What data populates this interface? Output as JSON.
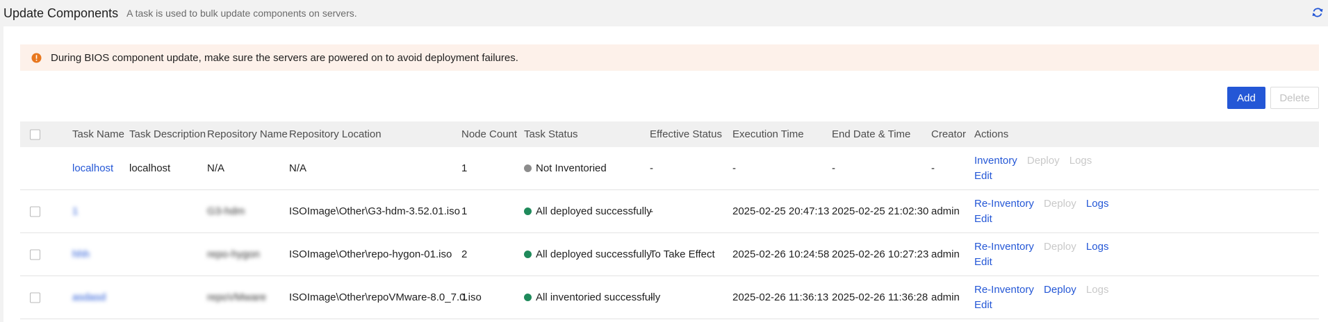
{
  "header": {
    "title": "Update Components",
    "subtitle": "A task is used to bulk update components on servers."
  },
  "alert": {
    "message": "During BIOS component update, make sure the servers are powered on to avoid deployment failures."
  },
  "toolbar": {
    "add_label": "Add",
    "delete_label": "Delete"
  },
  "columns": {
    "task_name": "Task Name",
    "task_description": "Task Description",
    "repository_name": "Repository Name",
    "repository_location": "Repository Location",
    "node_count": "Node Count",
    "task_status": "Task Status",
    "effective_status": "Effective Status",
    "execution_time": "Execution Time",
    "end_date_time": "End Date & Time",
    "creator": "Creator",
    "actions": "Actions"
  },
  "rows": [
    {
      "task_name": "localhost",
      "task_description": "localhost",
      "repository_name": "N/A",
      "repository_location": "N/A",
      "node_count": "1",
      "task_status": "Not Inventoried",
      "status_color": "#8c8c8c",
      "effective_status": "-",
      "execution_time": "-",
      "end_date_time": "-",
      "creator": "-",
      "action_inventory": "Inventory",
      "action_deploy": "Deploy",
      "action_logs": "Logs",
      "action_edit": "Edit"
    },
    {
      "task_name": "1",
      "task_description": "",
      "repository_name": "G3-hdm",
      "repository_location": "ISOImage\\Other\\G3-hdm-3.52.01.iso",
      "node_count": "1",
      "task_status": "All deployed successfully",
      "status_color": "#1f8a5b",
      "effective_status": "-",
      "execution_time": "2025-02-25 20:47:13",
      "end_date_time": "2025-02-25 21:02:30",
      "creator": "admin",
      "action_inventory": "Re-Inventory",
      "action_deploy": "Deploy",
      "action_logs": "Logs",
      "action_edit": "Edit"
    },
    {
      "task_name": "hhh",
      "task_description": "",
      "repository_name": "repo-hygon",
      "repository_location": "ISOImage\\Other\\repo-hygon-01.iso",
      "node_count": "2",
      "task_status": "All deployed successfully",
      "status_color": "#1f8a5b",
      "effective_status": "To Take Effect",
      "execution_time": "2025-02-26 10:24:58",
      "end_date_time": "2025-02-26 10:27:23",
      "creator": "admin",
      "action_inventory": "Re-Inventory",
      "action_deploy": "Deploy",
      "action_logs": "Logs",
      "action_edit": "Edit"
    },
    {
      "task_name": "asdasd",
      "task_description": "",
      "repository_name": "repoVMware",
      "repository_location": "ISOImage\\Other\\repoVMware-8.0_7.0.iso",
      "node_count": "1",
      "task_status": "All inventoried successfully",
      "status_color": "#1f8a5b",
      "effective_status": "-",
      "execution_time": "2025-02-26 11:36:13",
      "end_date_time": "2025-02-26 11:36:28",
      "creator": "admin",
      "action_inventory": "Re-Inventory",
      "action_deploy": "Deploy",
      "action_logs": "Logs",
      "action_edit": "Edit"
    }
  ]
}
